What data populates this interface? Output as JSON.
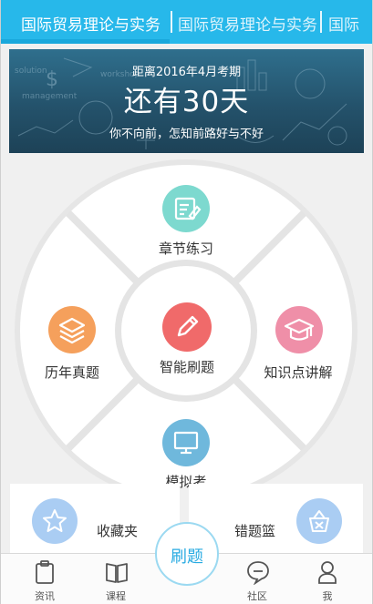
{
  "top_tabs": [
    {
      "label": "国际贸易理论与实务",
      "active": true
    },
    {
      "label": "国际贸易理论与实务",
      "active": false
    },
    {
      "label": "国际",
      "active": false
    }
  ],
  "banner": {
    "line1": "距离2016年4月考期",
    "line2": "还有30天",
    "line3": "你不向前，怎知前路好与不好"
  },
  "wheel": {
    "top": {
      "label": "章节练习",
      "icon": "edit-note-icon",
      "color": "#7dd9cf"
    },
    "left": {
      "label": "历年真题",
      "icon": "layers-icon",
      "color": "#f5a05c"
    },
    "center": {
      "label": "智能刷题",
      "icon": "pencil-icon",
      "color": "#f06a6a"
    },
    "right": {
      "label": "知识点讲解",
      "icon": "graduation-cap-icon",
      "color": "#ef8fa8"
    },
    "bottom": {
      "label": "模拟考",
      "icon": "monitor-icon",
      "color": "#6fb8dc"
    }
  },
  "cards": {
    "favorites": {
      "label": "收藏夹",
      "icon": "star-icon",
      "color": "#aacdf3"
    },
    "wrong": {
      "label": "错题篮",
      "icon": "basket-icon",
      "color": "#aacdf3"
    }
  },
  "nav": {
    "items": [
      {
        "label": "资讯",
        "icon": "clipboard-icon"
      },
      {
        "label": "课程",
        "icon": "book-icon"
      },
      {
        "label": "社区",
        "icon": "chat-bubble-icon"
      },
      {
        "label": "我",
        "icon": "person-icon"
      }
    ],
    "center_button": "刷题",
    "accent": "#29abe2"
  }
}
